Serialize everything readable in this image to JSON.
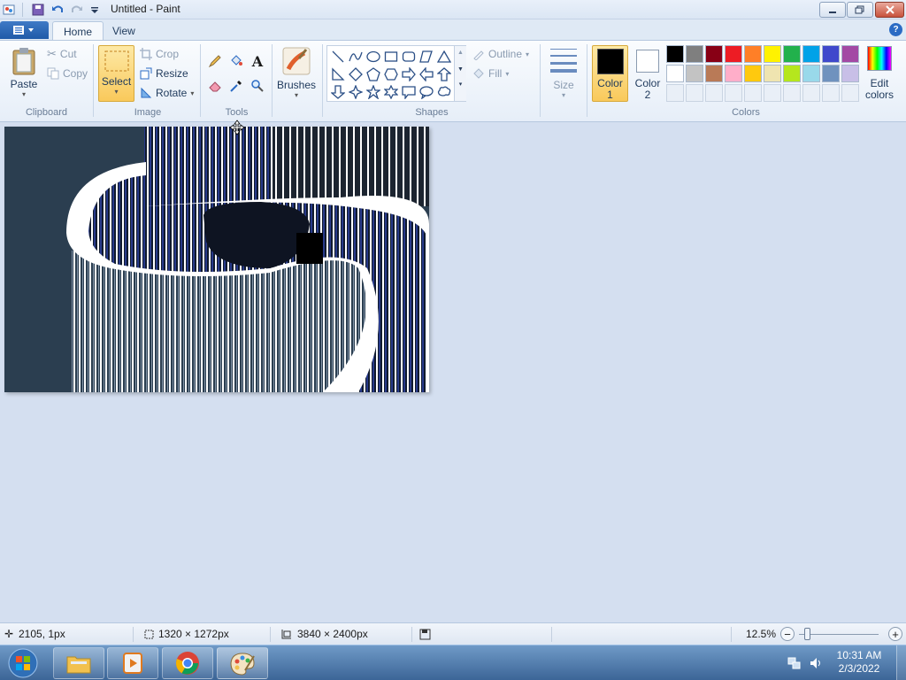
{
  "window": {
    "title": "Untitled - Paint"
  },
  "tabs": [
    {
      "label": "Home"
    },
    {
      "label": "View"
    }
  ],
  "clipboard": {
    "paste": "Paste",
    "cut": "Cut",
    "copy": "Copy",
    "group": "Clipboard"
  },
  "image": {
    "select": "Select",
    "crop": "Crop",
    "resize": "Resize",
    "rotate": "Rotate",
    "group": "Image"
  },
  "tools": {
    "group": "Tools"
  },
  "brushes": {
    "label": "Brushes"
  },
  "shapes": {
    "outline": "Outline",
    "fill": "Fill",
    "group": "Shapes"
  },
  "size": {
    "label": "Size"
  },
  "colors": {
    "color1_line1": "Color",
    "color1_line2": "1",
    "color2_line1": "Color",
    "color2_line2": "2",
    "edit_line1": "Edit",
    "edit_line2": "colors",
    "group": "Colors",
    "color1_value": "#000000",
    "color2_value": "#ffffff",
    "palette_row1": [
      "#000000",
      "#7f7f7f",
      "#880015",
      "#ed1c24",
      "#ff7f27",
      "#fff200",
      "#22b14c",
      "#00a2e8",
      "#3f48cc",
      "#a349a4"
    ],
    "palette_row2": [
      "#ffffff",
      "#c3c3c3",
      "#b97a57",
      "#ffaec9",
      "#ffc90e",
      "#efe4b0",
      "#b5e61d",
      "#99d9ea",
      "#7092be",
      "#c8bfe7"
    ]
  },
  "status": {
    "cursor_pos": "2105, 1px",
    "selection_size": "1320 × 1272px",
    "image_size": "3840 × 2400px",
    "zoom": "12.5%"
  },
  "taskbar": {
    "time": "10:31 AM",
    "date": "2/3/2022"
  }
}
